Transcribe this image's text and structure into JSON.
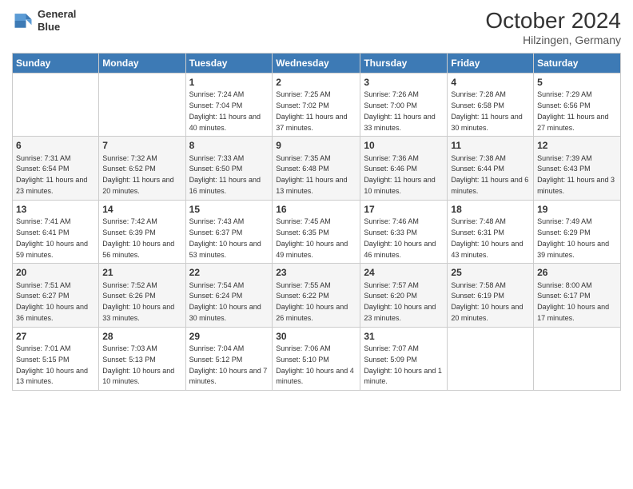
{
  "header": {
    "logo": {
      "line1": "General",
      "line2": "Blue"
    },
    "title": "October 2024",
    "location": "Hilzingen, Germany"
  },
  "weekdays": [
    "Sunday",
    "Monday",
    "Tuesday",
    "Wednesday",
    "Thursday",
    "Friday",
    "Saturday"
  ],
  "weeks": [
    [
      {
        "day": "",
        "info": ""
      },
      {
        "day": "",
        "info": ""
      },
      {
        "day": "1",
        "info": "Sunrise: 7:24 AM\nSunset: 7:04 PM\nDaylight: 11 hours and 40 minutes."
      },
      {
        "day": "2",
        "info": "Sunrise: 7:25 AM\nSunset: 7:02 PM\nDaylight: 11 hours and 37 minutes."
      },
      {
        "day": "3",
        "info": "Sunrise: 7:26 AM\nSunset: 7:00 PM\nDaylight: 11 hours and 33 minutes."
      },
      {
        "day": "4",
        "info": "Sunrise: 7:28 AM\nSunset: 6:58 PM\nDaylight: 11 hours and 30 minutes."
      },
      {
        "day": "5",
        "info": "Sunrise: 7:29 AM\nSunset: 6:56 PM\nDaylight: 11 hours and 27 minutes."
      }
    ],
    [
      {
        "day": "6",
        "info": "Sunrise: 7:31 AM\nSunset: 6:54 PM\nDaylight: 11 hours and 23 minutes."
      },
      {
        "day": "7",
        "info": "Sunrise: 7:32 AM\nSunset: 6:52 PM\nDaylight: 11 hours and 20 minutes."
      },
      {
        "day": "8",
        "info": "Sunrise: 7:33 AM\nSunset: 6:50 PM\nDaylight: 11 hours and 16 minutes."
      },
      {
        "day": "9",
        "info": "Sunrise: 7:35 AM\nSunset: 6:48 PM\nDaylight: 11 hours and 13 minutes."
      },
      {
        "day": "10",
        "info": "Sunrise: 7:36 AM\nSunset: 6:46 PM\nDaylight: 11 hours and 10 minutes."
      },
      {
        "day": "11",
        "info": "Sunrise: 7:38 AM\nSunset: 6:44 PM\nDaylight: 11 hours and 6 minutes."
      },
      {
        "day": "12",
        "info": "Sunrise: 7:39 AM\nSunset: 6:43 PM\nDaylight: 11 hours and 3 minutes."
      }
    ],
    [
      {
        "day": "13",
        "info": "Sunrise: 7:41 AM\nSunset: 6:41 PM\nDaylight: 10 hours and 59 minutes."
      },
      {
        "day": "14",
        "info": "Sunrise: 7:42 AM\nSunset: 6:39 PM\nDaylight: 10 hours and 56 minutes."
      },
      {
        "day": "15",
        "info": "Sunrise: 7:43 AM\nSunset: 6:37 PM\nDaylight: 10 hours and 53 minutes."
      },
      {
        "day": "16",
        "info": "Sunrise: 7:45 AM\nSunset: 6:35 PM\nDaylight: 10 hours and 49 minutes."
      },
      {
        "day": "17",
        "info": "Sunrise: 7:46 AM\nSunset: 6:33 PM\nDaylight: 10 hours and 46 minutes."
      },
      {
        "day": "18",
        "info": "Sunrise: 7:48 AM\nSunset: 6:31 PM\nDaylight: 10 hours and 43 minutes."
      },
      {
        "day": "19",
        "info": "Sunrise: 7:49 AM\nSunset: 6:29 PM\nDaylight: 10 hours and 39 minutes."
      }
    ],
    [
      {
        "day": "20",
        "info": "Sunrise: 7:51 AM\nSunset: 6:27 PM\nDaylight: 10 hours and 36 minutes."
      },
      {
        "day": "21",
        "info": "Sunrise: 7:52 AM\nSunset: 6:26 PM\nDaylight: 10 hours and 33 minutes."
      },
      {
        "day": "22",
        "info": "Sunrise: 7:54 AM\nSunset: 6:24 PM\nDaylight: 10 hours and 30 minutes."
      },
      {
        "day": "23",
        "info": "Sunrise: 7:55 AM\nSunset: 6:22 PM\nDaylight: 10 hours and 26 minutes."
      },
      {
        "day": "24",
        "info": "Sunrise: 7:57 AM\nSunset: 6:20 PM\nDaylight: 10 hours and 23 minutes."
      },
      {
        "day": "25",
        "info": "Sunrise: 7:58 AM\nSunset: 6:19 PM\nDaylight: 10 hours and 20 minutes."
      },
      {
        "day": "26",
        "info": "Sunrise: 8:00 AM\nSunset: 6:17 PM\nDaylight: 10 hours and 17 minutes."
      }
    ],
    [
      {
        "day": "27",
        "info": "Sunrise: 7:01 AM\nSunset: 5:15 PM\nDaylight: 10 hours and 13 minutes."
      },
      {
        "day": "28",
        "info": "Sunrise: 7:03 AM\nSunset: 5:13 PM\nDaylight: 10 hours and 10 minutes."
      },
      {
        "day": "29",
        "info": "Sunrise: 7:04 AM\nSunset: 5:12 PM\nDaylight: 10 hours and 7 minutes."
      },
      {
        "day": "30",
        "info": "Sunrise: 7:06 AM\nSunset: 5:10 PM\nDaylight: 10 hours and 4 minutes."
      },
      {
        "day": "31",
        "info": "Sunrise: 7:07 AM\nSunset: 5:09 PM\nDaylight: 10 hours and 1 minute."
      },
      {
        "day": "",
        "info": ""
      },
      {
        "day": "",
        "info": ""
      }
    ]
  ]
}
